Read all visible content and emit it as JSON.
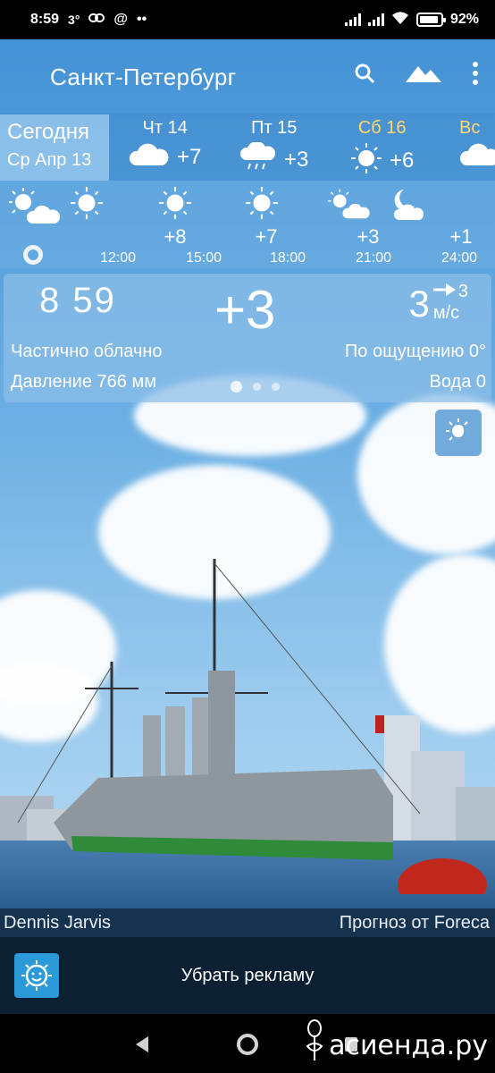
{
  "status_bar": {
    "time": "8:59",
    "notif_temp": "3°",
    "battery": "92%",
    "battery_level": 0.92
  },
  "header": {
    "city": "Санкт-Петербург",
    "icons": [
      "search-icon",
      "landscape-icon",
      "more-vert-icon"
    ]
  },
  "forecast": {
    "today": {
      "label": "Сегодня",
      "date": "Ср Апр 13"
    },
    "days": [
      {
        "name": "Чт 14",
        "temp": "+7",
        "icon": "cloud-icon",
        "color": "#ffffff"
      },
      {
        "name": "Пт 15",
        "temp": "+3",
        "icon": "rain-cloud-icon",
        "color": "#ffffff"
      },
      {
        "name": "Сб 16",
        "temp": "+6",
        "icon": "sun-icon",
        "color": "#ffd86b"
      },
      {
        "name": "Вс",
        "temp": "",
        "icon": "cloud-icon",
        "color": "#ffd86b"
      }
    ]
  },
  "hourly": {
    "hours": [
      {
        "time": "12:00",
        "temp": "",
        "icon": "sun-icon"
      },
      {
        "time": "15:00",
        "temp": "+8",
        "icon": "sun-icon"
      },
      {
        "time": "18:00",
        "temp": "+7",
        "icon": "sun-icon"
      },
      {
        "time": "21:00",
        "temp": "+3",
        "icon": "partly-cloudy-icon"
      },
      {
        "time": "24:00",
        "temp": "+1",
        "icon": "moon-cloud-icon"
      }
    ]
  },
  "current": {
    "time": "8 59",
    "temp": "+3",
    "wind_speed": "3",
    "wind_gust": "3",
    "wind_unit": "м/с",
    "condition": "Частично облачно",
    "feels_like": "По ощущению 0°",
    "pressure": "Давление 766 мм",
    "water": "Вода 0"
  },
  "credits": {
    "photo_author": "Dennis Jarvis",
    "provider": "Прогноз от Foreca"
  },
  "ad": {
    "remove_label": "Убрать рекламу"
  },
  "watermark": {
    "text": "асиенда.ру"
  }
}
